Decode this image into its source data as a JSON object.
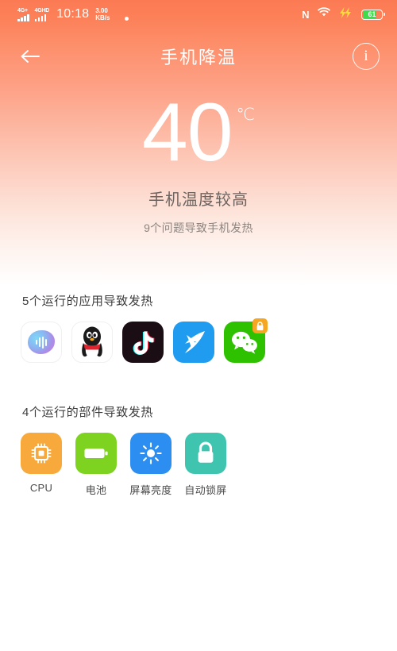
{
  "status_bar": {
    "signal1_label": "4G+",
    "signal2_label": "4GHD",
    "time": "10:18",
    "net_speed_value": "3.00",
    "net_speed_unit": "KB/s",
    "nfc_label": "N",
    "battery_percent": "61",
    "icons": [
      "signal-bars-icon",
      "dot-icon",
      "nfc-icon",
      "wifi-icon",
      "charging-bolt-icon",
      "battery-icon"
    ]
  },
  "header": {
    "title": "手机降温",
    "back_icon": "back-arrow-icon",
    "info_label": "i"
  },
  "temperature": {
    "value": "40",
    "unit": "℃",
    "status": "手机温度较高",
    "subtitle": "9个问题导致手机发热"
  },
  "apps_section": {
    "title": "5个运行的应用导致发热",
    "items": [
      {
        "name": "xiaoai-assistant",
        "icon": "voice-wave-icon",
        "locked": false
      },
      {
        "name": "qq",
        "icon": "penguin-icon",
        "locked": false
      },
      {
        "name": "douyin",
        "icon": "music-note-icon",
        "locked": false
      },
      {
        "name": "dingtalk",
        "icon": "wing-icon",
        "locked": false
      },
      {
        "name": "wechat",
        "icon": "chat-bubbles-icon",
        "locked": true
      }
    ]
  },
  "components_section": {
    "title": "4个运行的部件导致发热",
    "items": [
      {
        "label": "CPU",
        "icon": "cpu-chip-icon",
        "color": "#f7a93b"
      },
      {
        "label": "电池",
        "icon": "battery-icon",
        "color": "#7ed321"
      },
      {
        "label": "屏幕亮度",
        "icon": "brightness-sun-icon",
        "color": "#2b8ef0"
      },
      {
        "label": "自动锁屏",
        "icon": "lock-icon",
        "color": "#3fc4b0"
      }
    ]
  },
  "colors": {
    "gradient_top": "#fb7a54",
    "gradient_bottom": "#ffffff",
    "battery_green": "#3ddc4a",
    "lock_badge": "#f5a623"
  }
}
